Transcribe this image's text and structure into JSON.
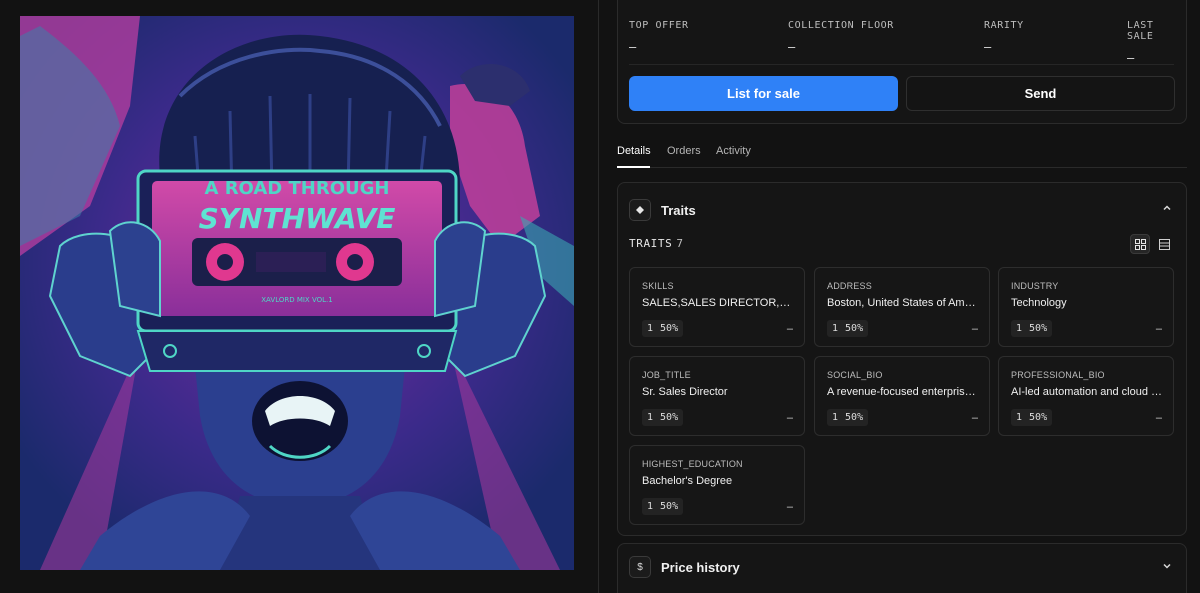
{
  "stats": [
    {
      "label": "TOP OFFER",
      "value": "–"
    },
    {
      "label": "COLLECTION FLOOR",
      "value": "–"
    },
    {
      "label": "RARITY",
      "value": "–"
    },
    {
      "label": "LAST SALE",
      "value": "–"
    }
  ],
  "actions": {
    "list_label": "List for sale",
    "send_label": "Send"
  },
  "tabs": [
    {
      "label": "Details",
      "active": true
    },
    {
      "label": "Orders",
      "active": false
    },
    {
      "label": "Activity",
      "active": false
    }
  ],
  "traits_section": {
    "title": "Traits",
    "icon": "diamond-icon",
    "count_label": "TRAITS",
    "count": "7",
    "items": [
      {
        "type": "SKILLS",
        "value": "SALES,SALES DIRECTOR,DAT…",
        "count": "1",
        "percent": "50%",
        "price": "–"
      },
      {
        "type": "ADDRESS",
        "value": "Boston, United States of Ameri…",
        "count": "1",
        "percent": "50%",
        "price": "–"
      },
      {
        "type": "INDUSTRY",
        "value": "Technology",
        "count": "1",
        "percent": "50%",
        "price": "–"
      },
      {
        "type": "JOB_TITLE",
        "value": "Sr. Sales Director",
        "count": "1",
        "percent": "50%",
        "price": "–"
      },
      {
        "type": "SOCIAL_BIO",
        "value": "A revenue-focused enterprise s…",
        "count": "1",
        "percent": "50%",
        "price": "–"
      },
      {
        "type": "PROFESSIONAL_BIO",
        "value": "AI-led automation and cloud m…",
        "count": "1",
        "percent": "50%",
        "price": "–"
      },
      {
        "type": "HIGHEST_EDUCATION",
        "value": "Bachelor's Degree",
        "count": "1",
        "percent": "50%",
        "price": "–"
      }
    ]
  },
  "price_history": {
    "title": "Price history",
    "icon": "dollar-icon",
    "icon_glyph": "$"
  },
  "artwork": {
    "title_line1": "A ROAD THROUGH",
    "title_line2": "SYNTHWAVE",
    "subtitle": "XAVLORD MIX VOL.1",
    "colors": {
      "navy": "#1d2a6e",
      "magenta": "#c2349b",
      "teal": "#4fd6c6"
    }
  },
  "colors": {
    "accent": "#2f81f7",
    "background": "#121212",
    "card": "#151515"
  }
}
